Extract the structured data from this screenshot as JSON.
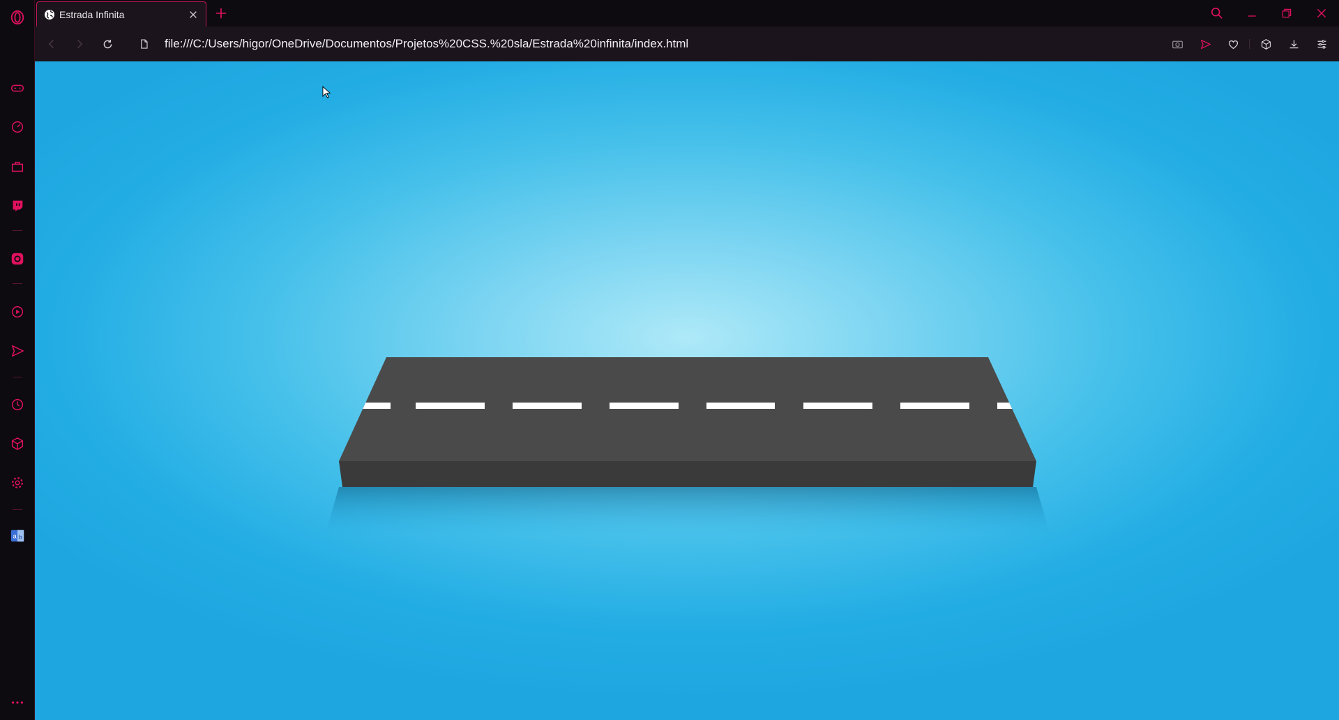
{
  "browser": {
    "tab": {
      "title": "Estrada Infinita"
    },
    "address_bar": {
      "url": "file:///C:/Users/higor/OneDrive/Documentos/Projetos%20CSS.%20sla/Estrada%20infinita/index.html"
    }
  },
  "sidebar": {
    "items": [
      {
        "icon": "opera-logo-icon"
      },
      {
        "icon": "gamepad-icon"
      },
      {
        "icon": "speedometer-icon"
      },
      {
        "icon": "briefcase-icon"
      },
      {
        "icon": "twitch-icon"
      },
      {
        "icon": "instagram-icon"
      },
      {
        "icon": "player-icon"
      },
      {
        "icon": "send-icon"
      },
      {
        "icon": "history-icon"
      },
      {
        "icon": "cube-icon"
      },
      {
        "icon": "settings-icon"
      },
      {
        "icon": "translate-icon"
      },
      {
        "icon": "more-icon"
      }
    ]
  },
  "theme": {
    "accent": "#e0115f",
    "chrome_bg": "#0d0b10",
    "toolbar_bg": "#1b141c",
    "road": "#4a4a4a",
    "road_side": "#3a3a3a",
    "lane_mark": "#ffffff"
  }
}
